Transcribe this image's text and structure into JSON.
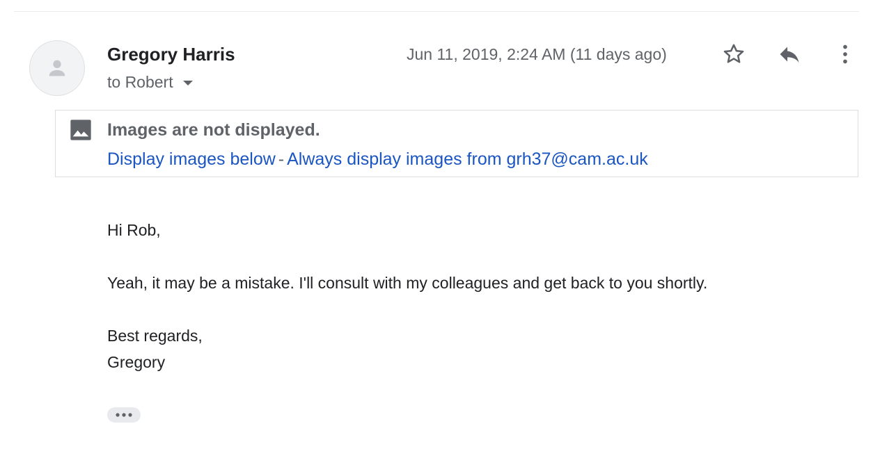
{
  "message": {
    "sender_name": "Gregory Harris",
    "recipient_label": "to Robert",
    "timestamp": "Jun 11, 2019, 2:24 AM (11 days ago)"
  },
  "actions": {
    "star_icon": "star-outline-icon",
    "reply_icon": "reply-icon",
    "more_icon": "more-vert-icon"
  },
  "image_notice": {
    "title": "Images are not displayed.",
    "display_below_link": "Display images below",
    "separator": "-",
    "always_display_link": "Always display images from grh37@cam.ac.uk"
  },
  "body": {
    "greeting": "Hi Rob,",
    "text": "Yeah, it may be a mistake. I'll consult with my colleagues and get back to you shortly.",
    "closing": "Best regards,",
    "signature": "Gregory"
  },
  "colors": {
    "link": "#1a55c2",
    "secondary_text": "#5f6368",
    "primary_text": "#202124"
  }
}
